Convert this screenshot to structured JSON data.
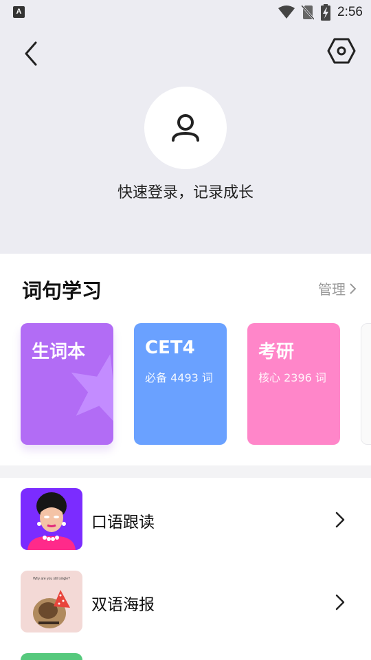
{
  "status_bar": {
    "time": "2:56",
    "notification_icon_letter": "A",
    "icons": [
      "wifi-icon",
      "no-sim-icon",
      "battery-charging-icon"
    ]
  },
  "header": {
    "back_icon": "back-arrow-icon",
    "settings_icon": "settings-hexagon-icon",
    "avatar_icon": "user-icon",
    "login_text": "快速登录，记录成长",
    "background_color": "#ececf2"
  },
  "study": {
    "title": "词句学习",
    "manage_label": "管理",
    "cards": [
      {
        "title": "生词本",
        "subtitle": "",
        "color": "#b26cf5",
        "icon": "star-icon"
      },
      {
        "title": "CET4",
        "subtitle": "必备 4493 词",
        "color": "#6aa1ff"
      },
      {
        "title": "考研",
        "subtitle": "核心 2396 词",
        "color": "#ff86c9"
      }
    ]
  },
  "list": {
    "items": [
      {
        "label": "口语跟读",
        "thumb": "cartoon-woman-thumbnail"
      },
      {
        "label": "双语海报",
        "thumb": "dog-party-poster-thumbnail",
        "thumb_caption": "Why are you still single?"
      }
    ]
  }
}
